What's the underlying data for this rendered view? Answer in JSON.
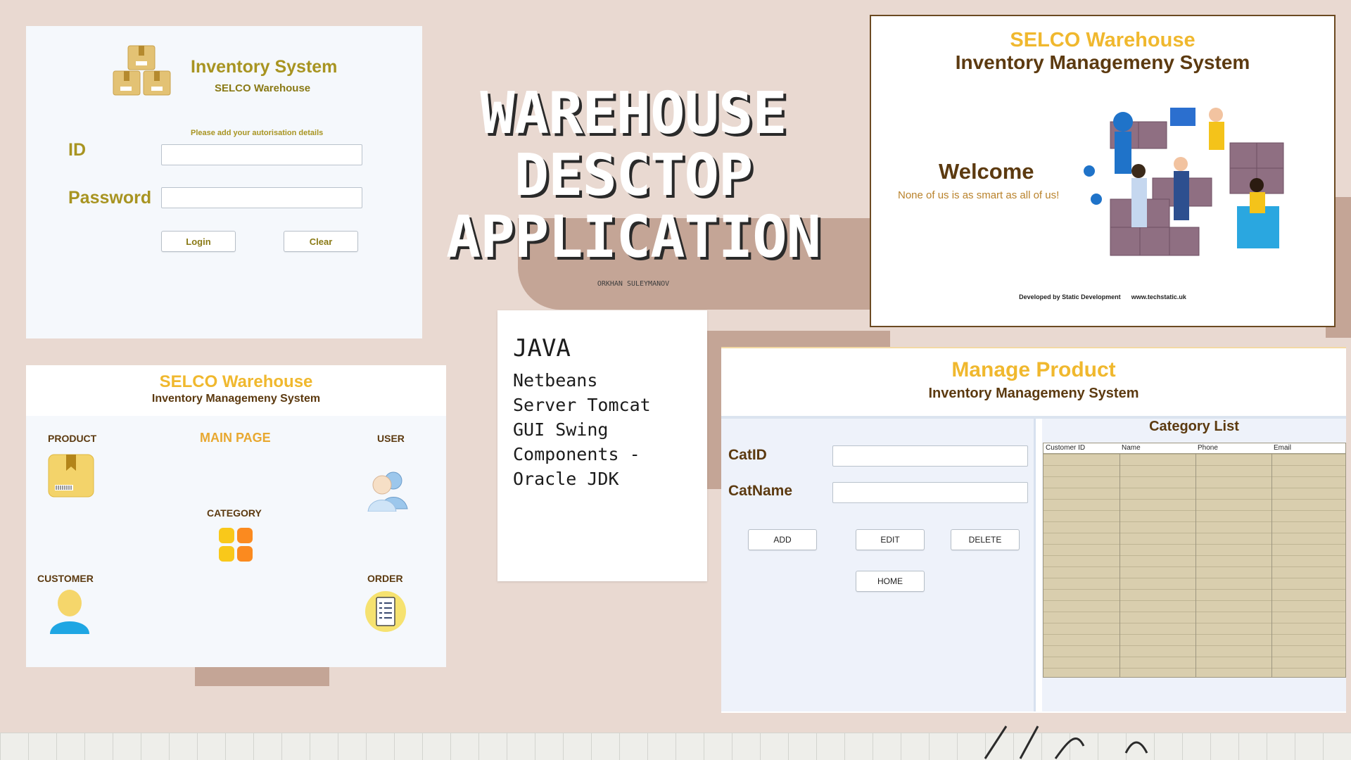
{
  "poster": {
    "title_lines": [
      "WAREHOUSE",
      "DESCTOP",
      "APPLICATION"
    ],
    "author": "ORKHAN SULEYMANOV"
  },
  "login": {
    "title": "Inventory System",
    "subtitle": "SELCO Warehouse",
    "hint": "Please add your autorisation details",
    "id_label": "ID",
    "password_label": "Password",
    "id_value": "",
    "password_value": "",
    "login_button": "Login",
    "clear_button": "Clear"
  },
  "welcome": {
    "brand": "SELCO Warehouse",
    "system": "Inventory Managemeny System",
    "heading": "Welcome",
    "tagline": "None of us is as smart as all of us!",
    "footer_dev": "Developed by Static Development",
    "footer_url": "www.techstatic.uk"
  },
  "main_page": {
    "brand": "SELCO Warehouse",
    "system": "Inventory Managemeny System",
    "title": "MAIN PAGE",
    "product": "PRODUCT",
    "user": "USER",
    "category": "CATEGORY",
    "customer": "CUSTOMER",
    "order": "ORDER"
  },
  "tech": {
    "heading": "JAVA",
    "items": [
      "Netbeans",
      "Server Tomcat",
      "GUI Swing",
      "Components -",
      "Oracle JDK"
    ]
  },
  "manage": {
    "title": "Manage Product",
    "system": "Inventory Managemeny System",
    "catid_label": "CatID",
    "catname_label": "CatName",
    "catid_value": "",
    "catname_value": "",
    "add_button": "ADD",
    "edit_button": "EDIT",
    "delete_button": "DELETE",
    "home_button": "HOME",
    "list_title": "Category List",
    "columns": [
      "Customer ID",
      "Name",
      "Phone",
      "Email"
    ]
  },
  "colors": {
    "background": "#e9d9d1",
    "brand_yellow": "#f0b82e",
    "dark_brown": "#5c3a10",
    "login_gold": "#a89421",
    "table_fill": "#d9ceae"
  }
}
